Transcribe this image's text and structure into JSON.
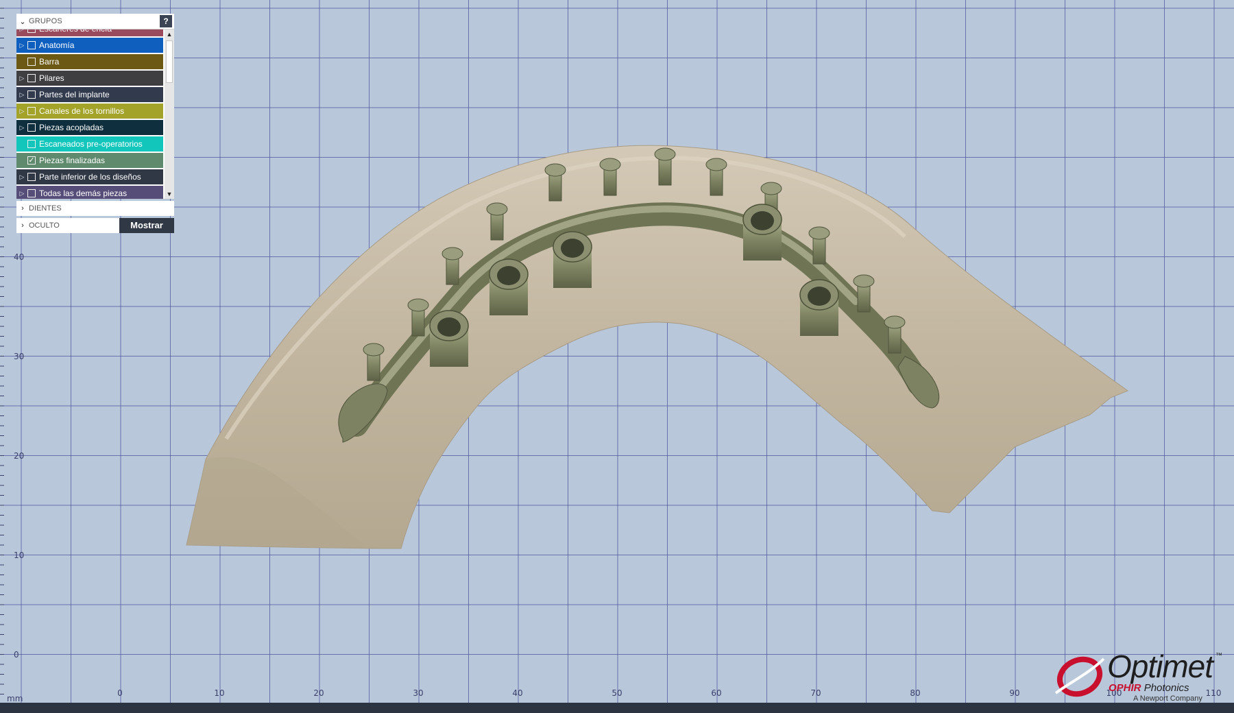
{
  "panel": {
    "groups_title": "GRUPOS",
    "help_label": "?",
    "items": [
      {
        "label": "Escáneres de encía",
        "color": "#9a4a5d",
        "expandable": true,
        "checked": false
      },
      {
        "label": "Anatomía",
        "color": "#0f5fbf",
        "expandable": true,
        "checked": false
      },
      {
        "label": "Barra",
        "color": "#6c5a14",
        "expandable": false,
        "checked": false
      },
      {
        "label": "Pilares",
        "color": "#3f3f42",
        "expandable": true,
        "checked": false
      },
      {
        "label": "Partes del implante",
        "color": "#323b4e",
        "expandable": true,
        "checked": false
      },
      {
        "label": "Canales de los tornillos",
        "color": "#a3a32a",
        "expandable": true,
        "checked": false
      },
      {
        "label": "Piezas acopladas",
        "color": "#0f2f3e",
        "expandable": true,
        "checked": false
      },
      {
        "label": "Escaneados pre-operatorios",
        "color": "#12c6bc",
        "expandable": false,
        "checked": false
      },
      {
        "label": "Piezas finalizadas",
        "color": "#5f8a6d",
        "expandable": false,
        "checked": true
      },
      {
        "label": "Parte inferior de los diseños",
        "color": "#303846",
        "expandable": true,
        "checked": false
      },
      {
        "label": "Todas las demás piezas",
        "color": "#564d78",
        "expandable": true,
        "checked": false
      }
    ],
    "teeth_title": "DIENTES",
    "hidden_title": "OCULTO",
    "show_button": "Mostrar"
  },
  "axes": {
    "unit": "mm",
    "x_ticks": [
      "0",
      "10",
      "20",
      "30",
      "40",
      "50",
      "60",
      "70",
      "80",
      "90",
      "100",
      "110"
    ],
    "y_ticks": [
      "40",
      "30",
      "20",
      "10",
      "0"
    ]
  },
  "logo": {
    "brand": "Optimet",
    "trademark": "™",
    "sub_red": "OPHIR",
    "sub_rest": "Photonics",
    "sub2": "A Newport Company"
  },
  "colors": {
    "background": "#b8c7da",
    "grid": "#4a4f9a",
    "model": "#c4b8a3",
    "bar": "#858a6a"
  }
}
